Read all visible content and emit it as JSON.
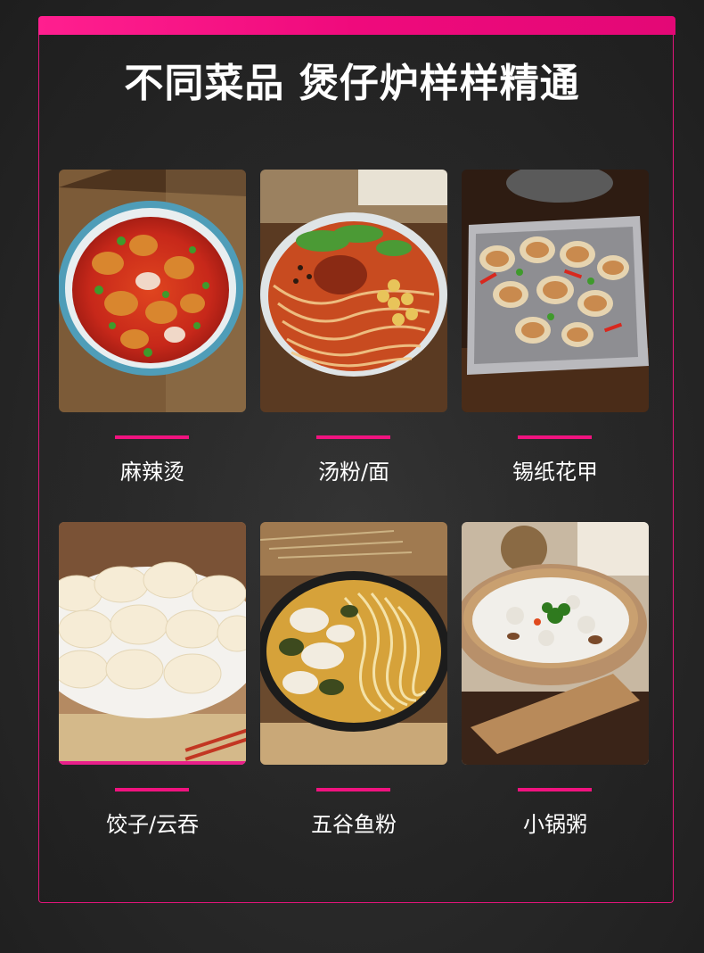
{
  "headline": "不同菜品 煲仔炉样样精通",
  "colors": {
    "accent": "#f0137f",
    "background": "#2b2b2b",
    "text": "#ffffff"
  },
  "dishes": [
    {
      "label": "麻辣烫",
      "image": "spicy-hotpot-bowl"
    },
    {
      "label": "汤粉/面",
      "image": "noodle-soup-bowl"
    },
    {
      "label": "锡纸花甲",
      "image": "foil-clams-tray"
    },
    {
      "label": "饺子/云吞",
      "image": "dumplings-plate"
    },
    {
      "label": "五谷鱼粉",
      "image": "fish-noodle-bowl"
    },
    {
      "label": "小锅粥",
      "image": "congee-claypot"
    }
  ]
}
